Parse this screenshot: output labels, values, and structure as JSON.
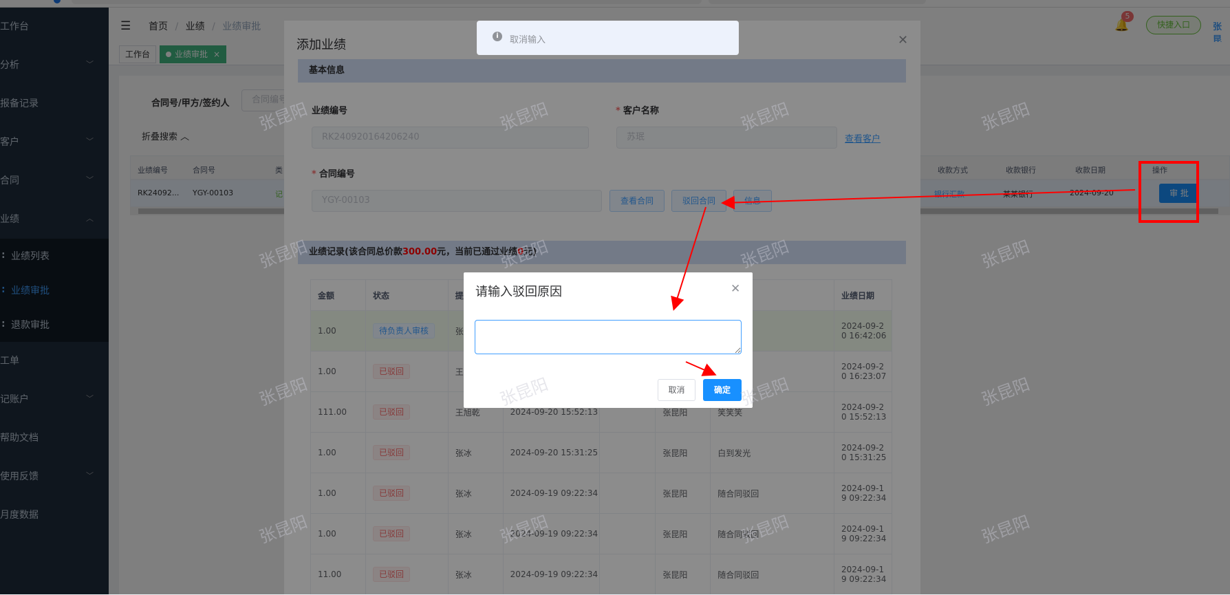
{
  "sidebar": {
    "items": [
      {
        "label": "工作台"
      },
      {
        "label": "分析"
      },
      {
        "label": "报备记录"
      },
      {
        "label": "客户"
      },
      {
        "label": "合同"
      },
      {
        "label": "业绩"
      },
      {
        "label": "工单"
      },
      {
        "label": "记账户"
      },
      {
        "label": "帮助文档"
      },
      {
        "label": "使用反馈"
      },
      {
        "label": "月度数据"
      }
    ],
    "sub_items": [
      {
        "label": "业绩列表"
      },
      {
        "label": "业绩审批"
      },
      {
        "label": "退款审批"
      }
    ]
  },
  "header": {
    "breadcrumb": [
      "首页",
      "业绩",
      "业绩审批"
    ],
    "notification_count": "5",
    "quick_entry": "快捷入口",
    "user": "张昆"
  },
  "tags": [
    "工作台",
    "业绩审批"
  ],
  "search": {
    "label": "合同号/甲方/签约人",
    "placeholder": "合同编号",
    "fold": "折叠搜索"
  },
  "list_table": {
    "headers": [
      "业绩编号",
      "合同号",
      "类",
      "收款方式",
      "收款银行",
      "收款日期",
      "操作"
    ],
    "row": {
      "perf_no": "RK24092...",
      "contract": "YGY-00103",
      "type_partial": "记",
      "pay_method": "银行汇款",
      "bank": "某某银行",
      "date": "2024-09-20",
      "action": "审 批"
    }
  },
  "dialog": {
    "title": "添加业绩",
    "basic_section": "基本信息",
    "perf_no_label": "业绩编号",
    "perf_no_value": "RK240920164206240",
    "customer_label": "客户名称",
    "customer_value": "苏珉",
    "view_customer": "查看客户",
    "contract_label": "合同编号",
    "contract_value": "YGY-00103",
    "btn_view_contract": "查看合同",
    "btn_reject_contract": "驳回合同",
    "btn_info": "信息",
    "records_prefix": "业绩记录(该合同总价款",
    "records_total": "300.00",
    "records_mid": "元，当前已通过业绩",
    "records_passed": "0",
    "records_suffix": "元)",
    "table_headers": [
      "金额",
      "状态",
      "提",
      "",
      "",
      "",
      "",
      "业绩日期"
    ],
    "rows": [
      {
        "amount": "1.00",
        "status": "待负责人审核",
        "status_type": "warn",
        "person": "张",
        "time": "",
        "sales": "",
        "note": "",
        "date1": "2024-09-2",
        "date2": "0 16:42:06"
      },
      {
        "amount": "1.00",
        "status": "已驳回",
        "status_type": "danger",
        "person": "王",
        "time": "",
        "sales": "",
        "note": "",
        "date1": "2024-09-2",
        "date2": "0 16:23:07"
      },
      {
        "amount": "111.00",
        "status": "已驳回",
        "status_type": "danger",
        "person": "王旭乾",
        "time": "2024-09-20 15:52:13",
        "sales": "张昆阳",
        "note": "笑笑笑",
        "date1": "2024-09-2",
        "date2": "0 15:52:13"
      },
      {
        "amount": "1.00",
        "status": "已驳回",
        "status_type": "danger",
        "person": "张冰",
        "time": "2024-09-20 15:31:25",
        "sales": "张昆阳",
        "note": "白到发光",
        "date1": "2024-09-2",
        "date2": "0 15:31:25"
      },
      {
        "amount": "1.00",
        "status": "已驳回",
        "status_type": "danger",
        "person": "张冰",
        "time": "2024-09-19 09:22:34",
        "sales": "张昆阳",
        "note": "随合同驳回",
        "date1": "2024-09-1",
        "date2": "9 09:22:34"
      },
      {
        "amount": "1.00",
        "status": "已驳回",
        "status_type": "danger",
        "person": "张冰",
        "time": "2024-09-19 09:22:34",
        "sales": "张昆阳",
        "note": "随合同驳回",
        "date1": "2024-09-1",
        "date2": "9 09:22:34"
      },
      {
        "amount": "11.00",
        "status": "已驳回",
        "status_type": "danger",
        "person": "张冰",
        "time": "2024-09-19 09:22:34",
        "sales": "张昆阳",
        "note": "随合同驳回",
        "date1": "2024-09-1",
        "date2": "9 09:22:34"
      }
    ]
  },
  "toast": {
    "text": "取消输入",
    "icon": "info-icon"
  },
  "reject_dialog": {
    "title": "请输入驳回原因",
    "value": "",
    "cancel": "取消",
    "ok": "确定"
  },
  "watermark": "张昆阳",
  "colors": {
    "primary": "#1890ff",
    "sidebar": "#1f2d3d",
    "annotation": "#ff0000",
    "tag_active": "#42b983"
  }
}
